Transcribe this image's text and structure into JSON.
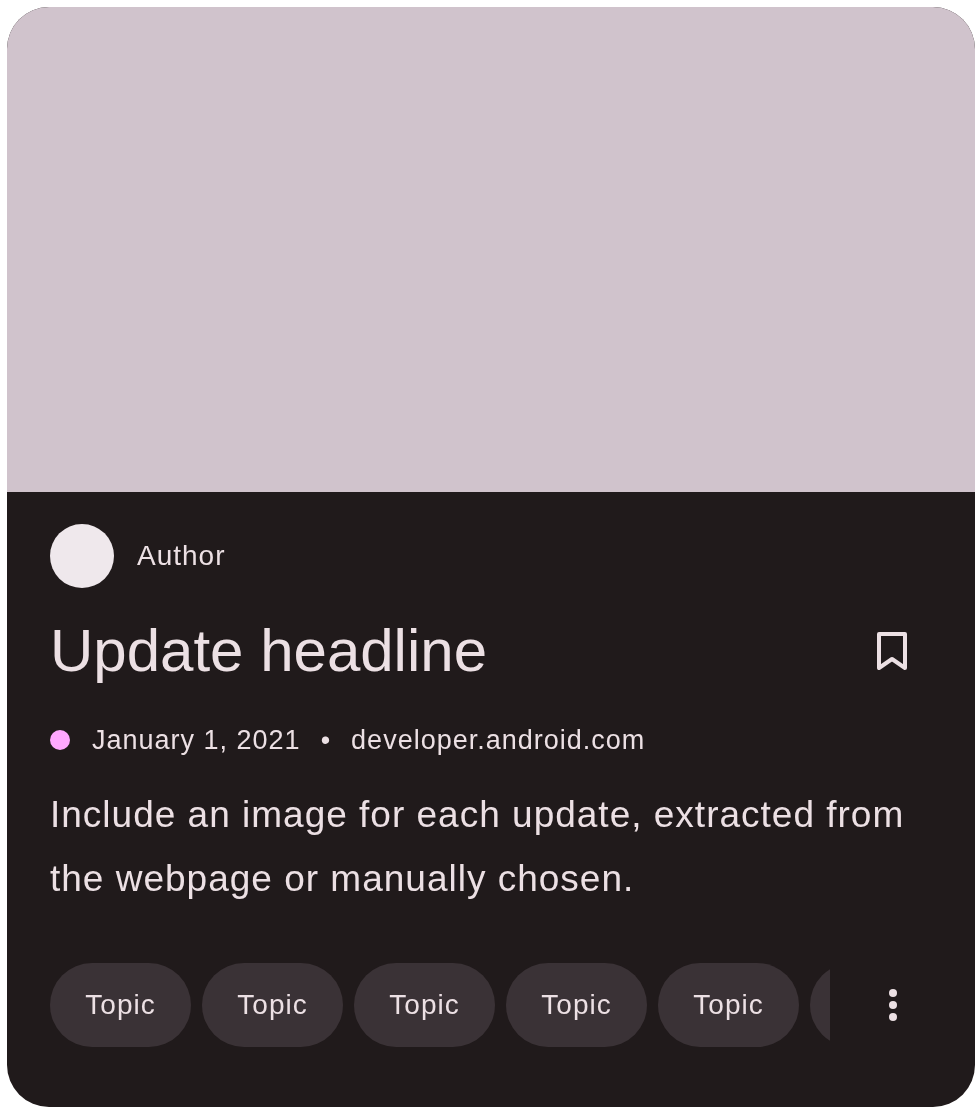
{
  "card": {
    "author": {
      "name": "Author"
    },
    "headline": "Update headline",
    "bookmarked": false,
    "meta": {
      "color": "#ffa8ff",
      "date": "January 1, 2021",
      "separator": "•",
      "source": "developer.android.com"
    },
    "description": "Include an image for each update, extracted from the webpage or manually chosen.",
    "topics": [
      {
        "label": "Topic"
      },
      {
        "label": "Topic"
      },
      {
        "label": "Topic"
      },
      {
        "label": "Topic"
      },
      {
        "label": "Topic"
      }
    ],
    "more_topics_cut_off": true
  }
}
